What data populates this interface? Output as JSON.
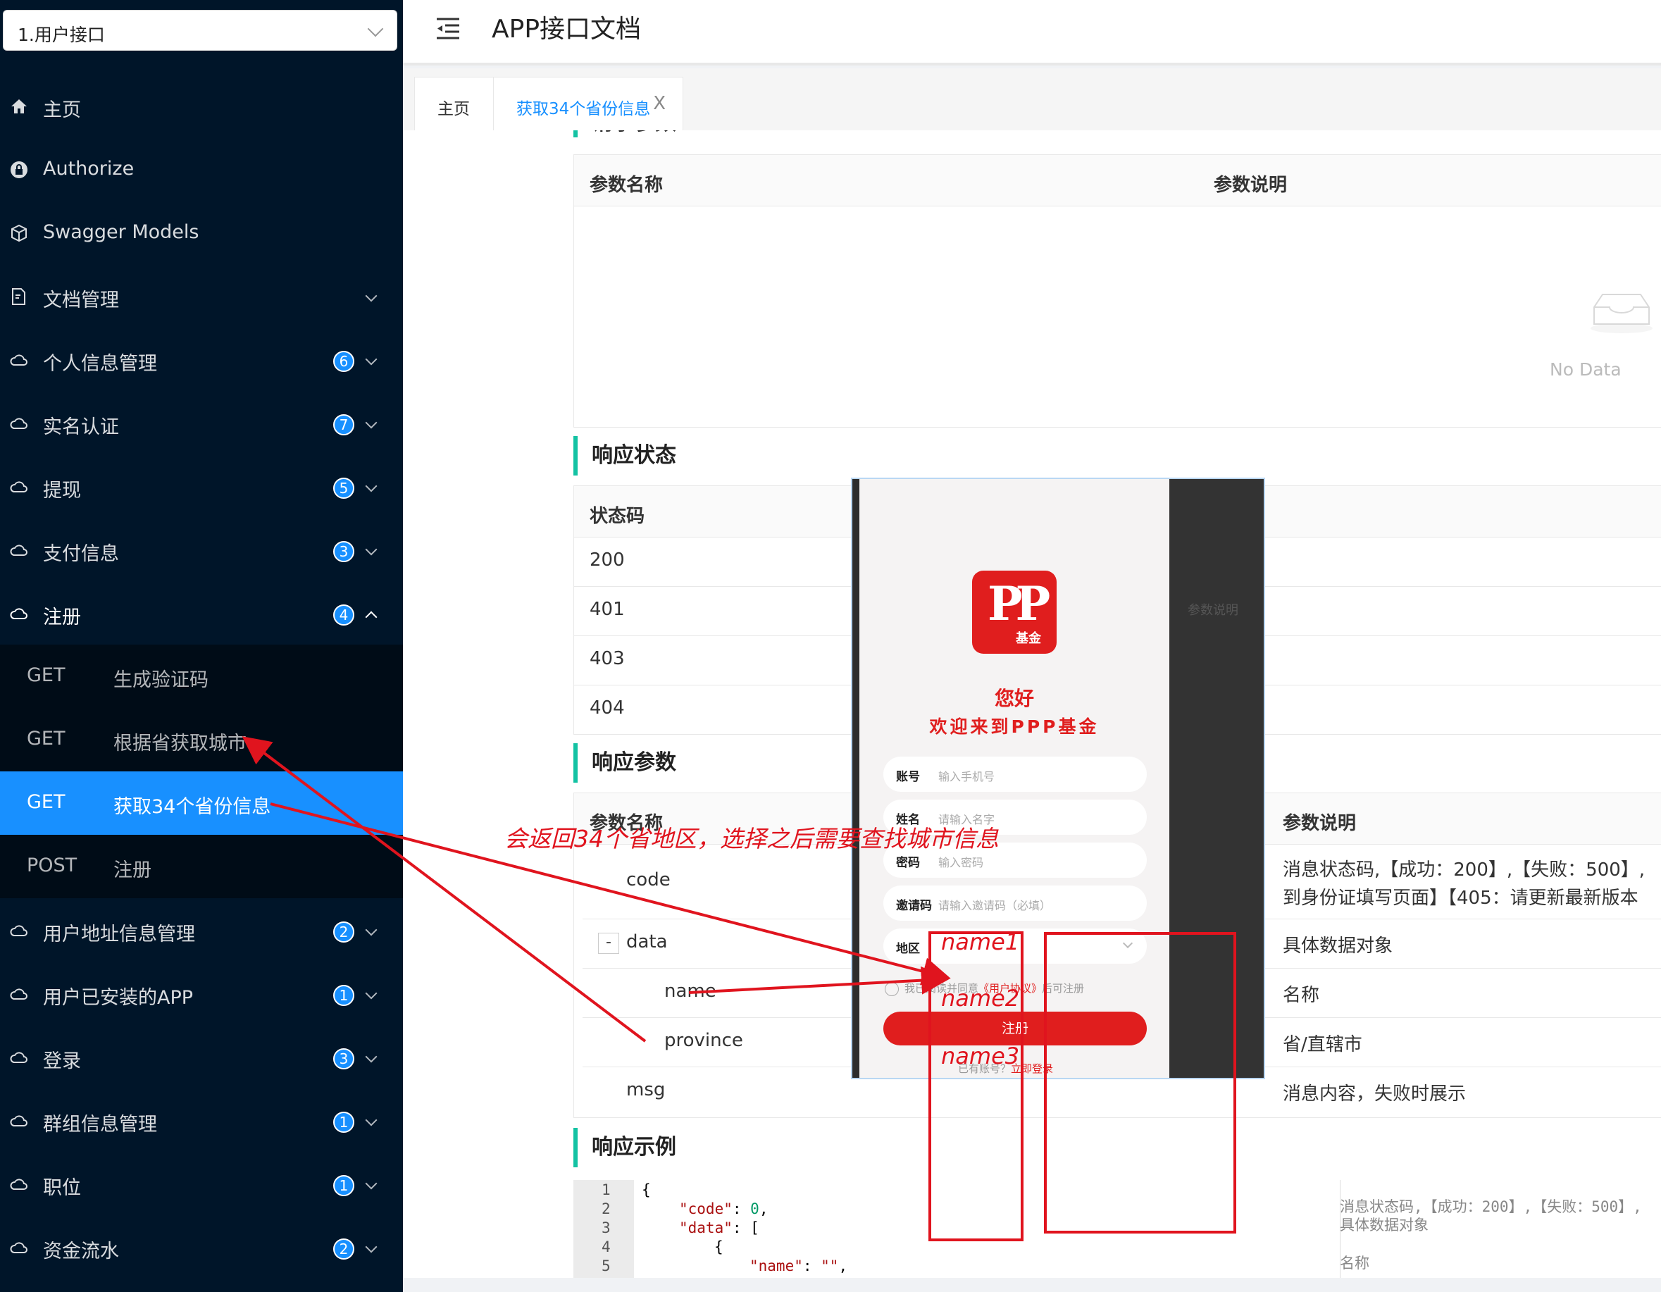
{
  "group_select": "1.用户接口",
  "header": {
    "title": "APP接口文档"
  },
  "menu": [
    {
      "label": "主页",
      "icon": "home-icon"
    },
    {
      "label": "Authorize",
      "icon": "lock-icon"
    },
    {
      "label": "Swagger Models",
      "icon": "cube-icon"
    },
    {
      "label": "文档管理",
      "icon": "doc-icon"
    },
    {
      "label": "个人信息管理",
      "badge": "6",
      "icon": "cloud-icon"
    },
    {
      "label": "实名认证",
      "badge": "7",
      "icon": "cloud-icon"
    },
    {
      "label": "提现",
      "badge": "5",
      "icon": "cloud-icon"
    },
    {
      "label": "支付信息",
      "badge": "3",
      "icon": "cloud-icon"
    },
    {
      "label": "注册",
      "badge": "4",
      "icon": "cloud-icon"
    },
    {
      "label": "用户地址信息管理",
      "badge": "2",
      "icon": "cloud-icon"
    },
    {
      "label": "用户已安装的APP",
      "badge": "1",
      "icon": "cloud-icon"
    },
    {
      "label": "登录",
      "badge": "3",
      "icon": "cloud-icon"
    },
    {
      "label": "群组信息管理",
      "badge": "1",
      "icon": "cloud-icon"
    },
    {
      "label": "职位",
      "badge": "1",
      "icon": "cloud-icon"
    },
    {
      "label": "资金流水",
      "badge": "2",
      "icon": "cloud-icon"
    }
  ],
  "submenu": [
    {
      "method": "GET",
      "label": "生成验证码"
    },
    {
      "method": "GET",
      "label": "根据省获取城市"
    },
    {
      "method": "GET",
      "label": "获取34个省份信息"
    },
    {
      "method": "POST",
      "label": "注册"
    }
  ],
  "tabs": [
    {
      "label": "主页"
    },
    {
      "label": "获取34个省份信息",
      "close": "X"
    }
  ],
  "request_params": {
    "partial_heading": "请求参数",
    "col_name": "参数名称",
    "col_desc": "参数说明",
    "empty": "No Data"
  },
  "response_status": {
    "heading": "响应状态",
    "col_code": "状态码",
    "codes": [
      "200",
      "401",
      "403",
      "404"
    ],
    "desc_col": "参数说明"
  },
  "response_params": {
    "heading": "响应参数",
    "col_name": "参数名称",
    "col_desc": "参数说明",
    "rows": [
      {
        "name": "code",
        "desc": "消息状态码,【成功：200】,【失败：500】,",
        "desc2": "到身份证填写页面】【405：请更新最新版本"
      },
      {
        "name": "data",
        "toggle": "-",
        "desc": "具体数据对象"
      },
      {
        "name": "name",
        "desc": "名称"
      },
      {
        "name": "province",
        "desc": "省/直辖市"
      },
      {
        "name": "msg",
        "desc": "消息内容，失败时展示"
      }
    ]
  },
  "response_example": {
    "heading": "响应示例",
    "lines": [
      "1",
      "2",
      "3",
      "4",
      "5"
    ],
    "code": {
      "l1": "{",
      "l2_key": "\"code\"",
      "l2_val": "0",
      "l3_key": "\"data\"",
      "l3_val": "[",
      "l4": "{",
      "l5_key": "\"name\"",
      "l5_val": "\"\""
    },
    "comments": [
      "消息状态码,【成功：200】,【失败：500】,",
      "具体数据对象",
      "名称"
    ]
  },
  "phone": {
    "logo_text": "PP",
    "logo_sub": "基金",
    "hello": "您好",
    "welcome": "欢迎来到PPP基金",
    "fields": [
      {
        "label": "账号",
        "placeholder": "输入手机号"
      },
      {
        "label": "姓名",
        "placeholder": "请输入名字"
      },
      {
        "label": "密码",
        "placeholder": "输入密码"
      },
      {
        "label": "邀请码",
        "placeholder": "请输入邀请码（必填）"
      },
      {
        "label": "地区",
        "placeholder": ""
      }
    ],
    "agree_pre": "我已阅读并同意",
    "agree_link": "《用户协议》",
    "agree_post": "后可注册",
    "register_btn": "注册",
    "login_pre": "已有账号？",
    "login_link": "立即登录"
  },
  "annotations": {
    "note": "会返回34个省地区，选择之后需要查找城市信息",
    "name1": "name1",
    "name2": "name2",
    "name3": "name3",
    "color": "#e0141e"
  }
}
